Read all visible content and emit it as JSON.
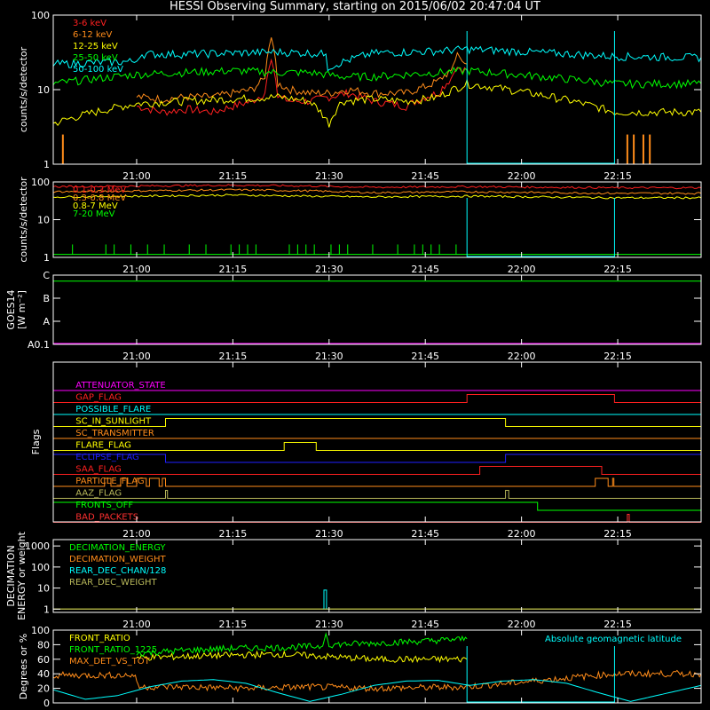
{
  "title": "HESSI Observing Summary, starting on 2015/06/02 20:47:04 UT",
  "colors": {
    "frame": "#ffffff",
    "red": "#ff2020",
    "orange": "#ff8c1a",
    "yellow": "#ffff00",
    "green": "#00ff00",
    "cyan": "#00ffff",
    "magenta": "#ff00ff",
    "blue": "#2020ff",
    "olive": "#b8b85a",
    "darkred": "#ff3030"
  },
  "time_axis": {
    "start_min": 0,
    "end_min": 101,
    "ticks": [
      {
        "t": 13,
        "label": "21:00"
      },
      {
        "t": 28,
        "label": "21:15"
      },
      {
        "t": 43,
        "label": "21:30"
      },
      {
        "t": 58,
        "label": "21:45"
      },
      {
        "t": 73,
        "label": "22:00"
      },
      {
        "t": 88,
        "label": "22:15"
      }
    ]
  },
  "chart_data": [
    {
      "type": "line",
      "panel": "count-rates",
      "ylabel": "counts/s/detector",
      "yscale": "log",
      "ylim": [
        1,
        100
      ],
      "yticks": [
        {
          "v": 1,
          "label": "1"
        },
        {
          "v": 10,
          "label": "10"
        },
        {
          "v": 100,
          "label": "100"
        }
      ],
      "data_gap": [
        64.5,
        87.5
      ],
      "series": [
        {
          "name": "3-6 keV",
          "color": "#ff2020",
          "x": [
            13,
            17,
            21,
            25,
            28,
            31,
            33,
            34,
            35,
            37,
            40,
            43,
            46,
            50,
            55,
            58,
            60,
            62,
            63,
            64.5
          ],
          "y": [
            6,
            5,
            5.5,
            5,
            6,
            7,
            9,
            25,
            8,
            7,
            7,
            8,
            9,
            7,
            6,
            8,
            9,
            14,
            20,
            18
          ]
        },
        {
          "name": "6-12 keV",
          "color": "#ff8c1a",
          "x": [
            13,
            17,
            21,
            25,
            28,
            31,
            33,
            34,
            35,
            37,
            40,
            43,
            46,
            50,
            55,
            58,
            60,
            62,
            63,
            64.5
          ],
          "y": [
            8,
            7.5,
            8,
            8,
            9,
            10,
            14,
            50,
            12,
            10,
            9,
            9,
            10,
            9,
            9,
            11,
            13,
            18,
            28,
            22
          ]
        },
        {
          "name": "12-25 keV",
          "color": "#ffff00",
          "x": [
            0,
            13,
            20,
            28,
            35,
            40,
            43,
            45,
            50,
            55,
            58,
            60,
            64.5,
            87.5,
            101
          ],
          "y": [
            3.5,
            6.5,
            7,
            7.5,
            8,
            7,
            3.5,
            7,
            7.5,
            7,
            7.5,
            8,
            12,
            5,
            5
          ]
        },
        {
          "name": "25-50 keV",
          "color": "#00ff00",
          "x": [
            0,
            13,
            20,
            28,
            35,
            40,
            45,
            50,
            55,
            60,
            64.5,
            87.5,
            101
          ],
          "y": [
            12,
            16,
            17,
            18,
            17,
            17,
            15,
            15,
            16,
            17,
            18,
            12,
            12
          ]
        },
        {
          "name": "50-100 keV",
          "color": "#00ffff",
          "x": [
            0,
            13,
            13.5,
            20,
            28,
            35,
            40,
            42.5,
            42.8,
            50,
            55,
            60,
            64.5,
            87.5,
            101
          ],
          "y": [
            22,
            24,
            30,
            30,
            31,
            32,
            31,
            30,
            20,
            31,
            32,
            33,
            35,
            28,
            27
          ]
        }
      ],
      "spikes": [
        {
          "color": "#ff8c1a",
          "t": [
            1.5,
            89.5,
            90.5,
            92,
            93
          ],
          "y": 2.5
        }
      ]
    },
    {
      "type": "line",
      "panel": "high-energy",
      "ylabel": "counts/s/detector",
      "yscale": "log",
      "ylim": [
        1,
        100
      ],
      "yticks": [
        {
          "v": 1,
          "label": "1"
        },
        {
          "v": 10,
          "label": "10"
        },
        {
          "v": 100,
          "label": "100"
        }
      ],
      "data_gap": [
        64.5,
        87.5
      ],
      "series": [
        {
          "name": "0.1-0.3 MeV",
          "color": "#ff2020",
          "x": [
            0,
            13,
            28,
            40,
            50,
            64.5,
            87.5,
            101
          ],
          "y": [
            75,
            78,
            82,
            78,
            72,
            75,
            70,
            70
          ]
        },
        {
          "name": "0.3-0.8 MeV",
          "color": "#ff8c1a",
          "x": [
            0,
            13,
            28,
            40,
            50,
            64.5,
            87.5,
            101
          ],
          "y": [
            55,
            58,
            62,
            58,
            52,
            55,
            50,
            50
          ]
        },
        {
          "name": "0.8-7 MeV",
          "color": "#ffff00",
          "x": [
            0,
            13,
            28,
            40,
            50,
            64.5,
            87.5,
            101
          ],
          "y": [
            40,
            42,
            45,
            42,
            40,
            42,
            38,
            38
          ]
        },
        {
          "name": "7-20 MeV",
          "color": "#00ff00",
          "x": [
            0,
            64.5,
            87.5,
            101
          ],
          "y": [
            1.2,
            1.2,
            1.2,
            1.2
          ]
        }
      ]
    },
    {
      "type": "line",
      "panel": "goes",
      "ylabel": "GOES14",
      "ylabel2": "[W m⁻²]",
      "yscale": "log",
      "ylim": [
        1e-08,
        1e-05
      ],
      "yticks": [
        {
          "v": 1e-08,
          "label": "A0.1"
        },
        {
          "v": 1e-07,
          "label": "A"
        },
        {
          "v": 1e-06,
          "label": "B"
        },
        {
          "v": 1e-05,
          "label": "C"
        }
      ],
      "series": [
        {
          "color": "#00ff00",
          "x": [
            0,
            101
          ],
          "y": [
            5.5e-06,
            5.5e-06
          ]
        }
      ],
      "baseline": {
        "color": "#ff00ff"
      }
    },
    {
      "type": "line",
      "panel": "flags",
      "ylabel": "Flags",
      "flags": [
        {
          "name": "ATTENUATOR_STATE",
          "color": "#ff00ff",
          "intervals": []
        },
        {
          "name": "GAP_FLAG",
          "color": "#ff2020",
          "intervals": [
            [
              64.5,
              87.5
            ]
          ]
        },
        {
          "name": "POSSIBLE_FLARE",
          "color": "#00ffff",
          "intervals": []
        },
        {
          "name": "SC_IN_SUNLIGHT",
          "color": "#ffff00",
          "intervals": [
            [
              17.5,
              70.5
            ]
          ]
        },
        {
          "name": "SC_TRANSMITTER",
          "color": "#ff8c1a",
          "intervals": []
        },
        {
          "name": "FLARE_FLAG",
          "color": "#ffff00",
          "intervals": [
            [
              36,
              41
            ]
          ]
        },
        {
          "name": "ECLIPSE_FLAG",
          "color": "#2020ff",
          "intervals": [
            [
              0,
              17.5
            ],
            [
              70.5,
              101
            ]
          ]
        },
        {
          "name": "SAA_FLAG",
          "color": "#ff2020",
          "intervals": [
            [
              66.5,
              85.5
            ]
          ]
        },
        {
          "name": "PARTICLE_FLAG",
          "color": "#ff8c1a",
          "intervals": [
            [
              8,
              9
            ],
            [
              10.5,
              11.5
            ],
            [
              13,
              14.5
            ],
            [
              15,
              16.5
            ],
            [
              17,
              17.5
            ],
            [
              84.5,
              86.5
            ],
            [
              87.2,
              87.4
            ]
          ]
        },
        {
          "name": "AAZ_FLAG",
          "color": "#b8b85a",
          "intervals": [
            [
              17.5,
              17.8
            ],
            [
              70.5,
              71
            ]
          ]
        },
        {
          "name": "FRONTS_OFF",
          "color": "#00ff00",
          "intervals": [
            [
              0,
              75.5
            ]
          ]
        },
        {
          "name": "BAD_PACKETS",
          "color": "#ff3030",
          "intervals": [
            [
              89.5,
              89.8
            ]
          ]
        }
      ]
    },
    {
      "type": "line",
      "panel": "decimation",
      "ylabel": "DECIMATION",
      "ylabel2": "ENERGY or weight",
      "yscale": "log",
      "ylim": [
        0.7,
        2000
      ],
      "yticks": [
        {
          "v": 1,
          "label": "1"
        },
        {
          "v": 10,
          "label": "10"
        },
        {
          "v": 100,
          "label": "100"
        },
        {
          "v": 1000,
          "label": "1000"
        }
      ],
      "series": [
        {
          "name": "DECIMATION_ENERGY",
          "color": "#00ff00",
          "x": [
            0,
            101
          ],
          "y": [
            1,
            1
          ]
        },
        {
          "name": "DECIMATION_WEIGHT",
          "color": "#ff8c1a",
          "x": [
            0,
            101
          ],
          "y": [
            1,
            1
          ]
        },
        {
          "name": "REAR_DEC_CHAN/128",
          "color": "#00ffff",
          "x": [
            42,
            42.2,
            42.2,
            42.6,
            42.6,
            42.8
          ],
          "y": [
            1,
            1,
            8,
            8,
            1,
            1
          ]
        },
        {
          "name": "REAR_DEC_WEIGHT",
          "color": "#b8b85a",
          "x": [
            0,
            101
          ],
          "y": [
            1,
            1
          ]
        }
      ]
    },
    {
      "type": "line",
      "panel": "ratios",
      "ylabel": "Degrees or %",
      "ylim": [
        0,
        100
      ],
      "yticks": [
        {
          "v": 0,
          "label": "0"
        },
        {
          "v": 20,
          "label": "20"
        },
        {
          "v": 40,
          "label": "40"
        },
        {
          "v": 60,
          "label": "60"
        },
        {
          "v": 80,
          "label": "80"
        },
        {
          "v": 100,
          "label": "100"
        }
      ],
      "data_gap": [
        64.5,
        87.5
      ],
      "annotation": "Absolute geomagnetic latitude",
      "series": [
        {
          "name": "FRONT_RATIO",
          "color": "#ffff00",
          "x": [
            13,
            25,
            35,
            40,
            50,
            64.5
          ],
          "y": [
            62,
            65,
            67,
            65,
            60,
            60
          ]
        },
        {
          "name": "FRONT_RATIO_1225",
          "color": "#00ff00",
          "x": [
            13,
            20,
            28,
            35,
            42,
            42.5,
            43,
            50,
            58,
            64.5
          ],
          "y": [
            68,
            72,
            75,
            76,
            78,
            95,
            80,
            82,
            85,
            88
          ]
        },
        {
          "name": "MAX_DET_VS_TOT",
          "color": "#ff8c1a",
          "x": [
            0,
            12.8,
            13.2,
            20,
            30,
            40,
            50,
            64.5,
            87.5,
            101
          ],
          "y": [
            38,
            38,
            22,
            22,
            20,
            22,
            20,
            22,
            40,
            40
          ]
        },
        {
          "color": "#00ffff",
          "kind": "latitude",
          "x": [
            0,
            5,
            10,
            15,
            20,
            25,
            30,
            35,
            40,
            45,
            50,
            55,
            60,
            65,
            70,
            75,
            80,
            85,
            90,
            95,
            101
          ],
          "y": [
            18,
            5,
            10,
            22,
            30,
            32,
            27,
            14,
            2,
            12,
            24,
            30,
            31,
            24,
            30,
            32,
            27,
            14,
            2,
            12,
            24
          ]
        }
      ]
    }
  ]
}
